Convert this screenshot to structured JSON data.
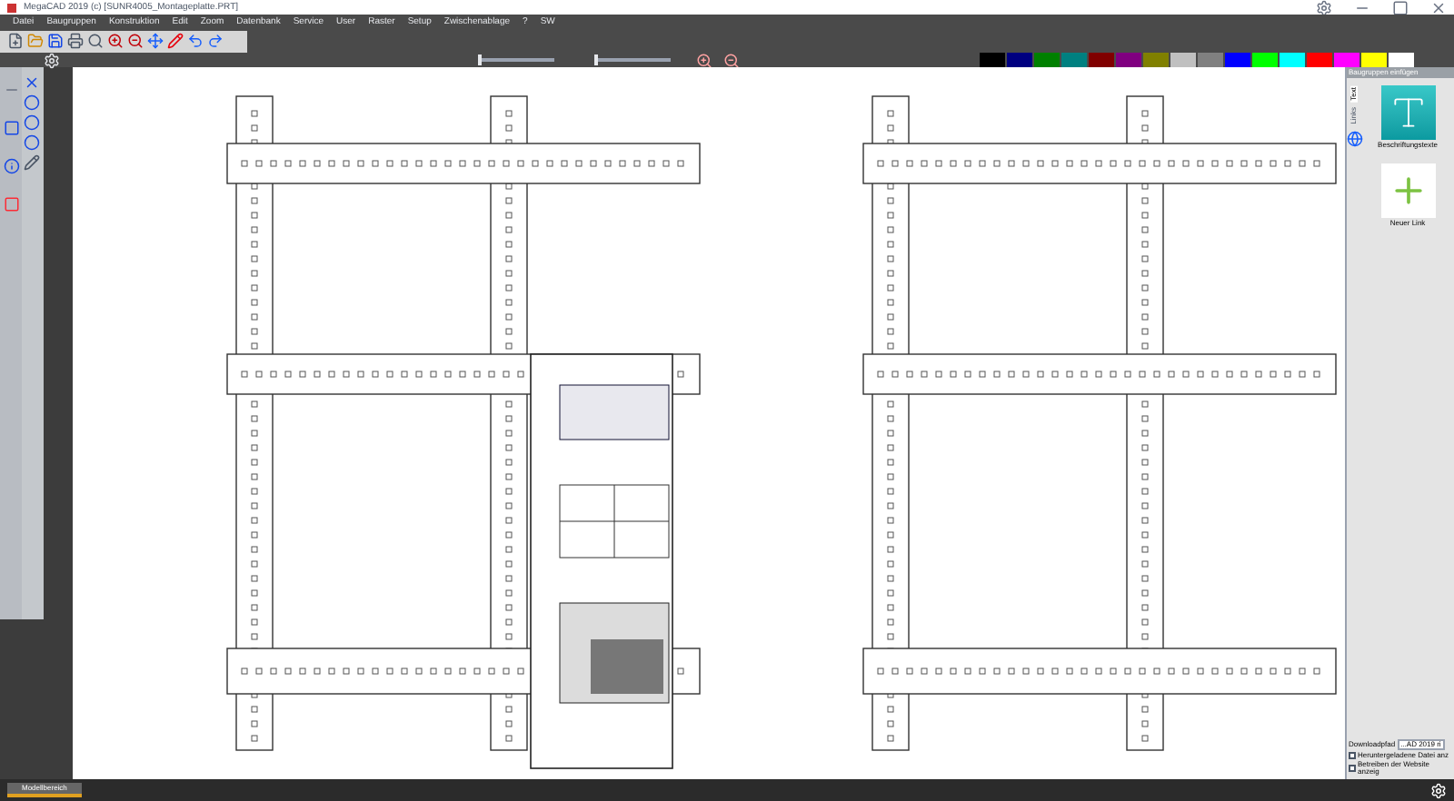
{
  "window": {
    "title": "MegaCAD 2019 (c) [SUNR4005_Montageplatte.PRT]"
  },
  "menu": [
    "Datei",
    "Baugruppen",
    "Konstruktion",
    "Edit",
    "Zoom",
    "Datenbank",
    "Service",
    "User",
    "Raster",
    "Setup",
    "Zwischenablage",
    "?",
    "SW"
  ],
  "sliders": [
    {
      "level": 0
    },
    {
      "level": 0
    }
  ],
  "palette": [
    {
      "color": "#000000"
    },
    {
      "color": "#000080"
    },
    {
      "color": "#008000"
    },
    {
      "color": "#008080"
    },
    {
      "color": "#800000"
    },
    {
      "color": "#800080"
    },
    {
      "color": "#808000"
    },
    {
      "color": "#c0c0c0"
    },
    {
      "color": "#808080"
    },
    {
      "color": "#0000ff"
    },
    {
      "color": "#00ff00"
    },
    {
      "color": "#00ffff"
    },
    {
      "color": "#ff0000"
    },
    {
      "color": "#ff00ff"
    },
    {
      "color": "#ffff00"
    },
    {
      "color": "#ffffff"
    }
  ],
  "panel": {
    "title": "Baugruppen einfügen",
    "tabs": [
      {
        "label": "Text",
        "selected": true
      },
      {
        "label": "Links",
        "selected": false
      }
    ],
    "items": [
      {
        "kind": "text",
        "label": "Beschriftungstexte"
      },
      {
        "kind": "link",
        "label": "Neuer Link"
      }
    ],
    "download_label": "Downloadpfad",
    "download_value": "...AD 2019 ri",
    "options": [
      {
        "label": "Heruntergeladene Datei anz",
        "checked": false
      },
      {
        "label": "Betreiben der Website anzeig",
        "checked": false
      }
    ]
  },
  "status_bar": {
    "tab": "Modellbereich"
  }
}
